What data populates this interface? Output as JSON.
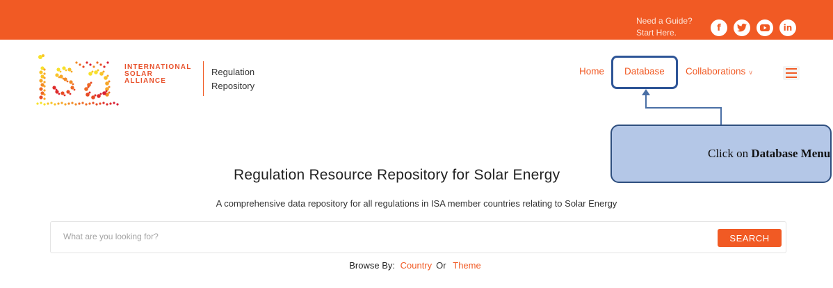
{
  "topbar": {
    "guide_line1": "Need a Guide?",
    "guide_line2": "Start Here.",
    "social": [
      {
        "icon": "facebook-icon",
        "glyph": "f"
      },
      {
        "icon": "twitter-icon",
        "glyph": "t"
      },
      {
        "icon": "youtube-icon",
        "glyph": "▶"
      },
      {
        "icon": "linkedin-icon",
        "glyph": "in"
      }
    ],
    "bg_color": "#f15a24"
  },
  "header": {
    "logo_text": "isa",
    "alliance_lines": [
      "INTERNATIONAL",
      "SOLAR",
      "ALLIANCE"
    ],
    "repo_line1": "Regulation",
    "repo_line2": "Repository"
  },
  "nav": {
    "home": "Home",
    "database": "Database",
    "collaborations": "Collaborations",
    "collab_chevron": "∨"
  },
  "callout": {
    "prefix": "Click on ",
    "bold": "Database Menu"
  },
  "main": {
    "title": "Regulation Resource Repository for Solar Energy",
    "subtitle": "A comprehensive data repository for all regulations in ISA member countries relating to Solar Energy",
    "search_placeholder": "What are you looking for?",
    "search_button": "SEARCH",
    "browse_label": "Browse By:",
    "browse_country": "Country",
    "browse_or": "Or",
    "browse_theme": "Theme"
  }
}
